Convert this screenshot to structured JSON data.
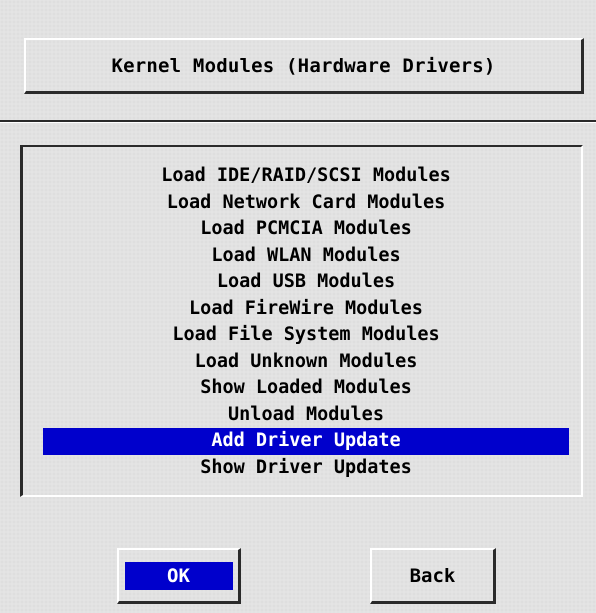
{
  "dialog": {
    "title": "Kernel Modules (Hardware Drivers)"
  },
  "menu": {
    "items": [
      {
        "label": "Load IDE/RAID/SCSI Modules",
        "selected": false
      },
      {
        "label": "Load Network Card Modules",
        "selected": false
      },
      {
        "label": "Load PCMCIA Modules",
        "selected": false
      },
      {
        "label": "Load WLAN Modules",
        "selected": false
      },
      {
        "label": "Load USB Modules",
        "selected": false
      },
      {
        "label": "Load FireWire Modules",
        "selected": false
      },
      {
        "label": "Load File System Modules",
        "selected": false
      },
      {
        "label": "Load Unknown Modules",
        "selected": false
      },
      {
        "label": "Show Loaded Modules",
        "selected": false
      },
      {
        "label": "Unload Modules",
        "selected": false
      },
      {
        "label": "Add Driver Update",
        "selected": true
      },
      {
        "label": "Show Driver Updates",
        "selected": false
      }
    ]
  },
  "buttons": {
    "ok_label": "OK",
    "back_label": "Back"
  },
  "colors": {
    "selection": "#0000cc",
    "background": "#e2e2e2"
  }
}
